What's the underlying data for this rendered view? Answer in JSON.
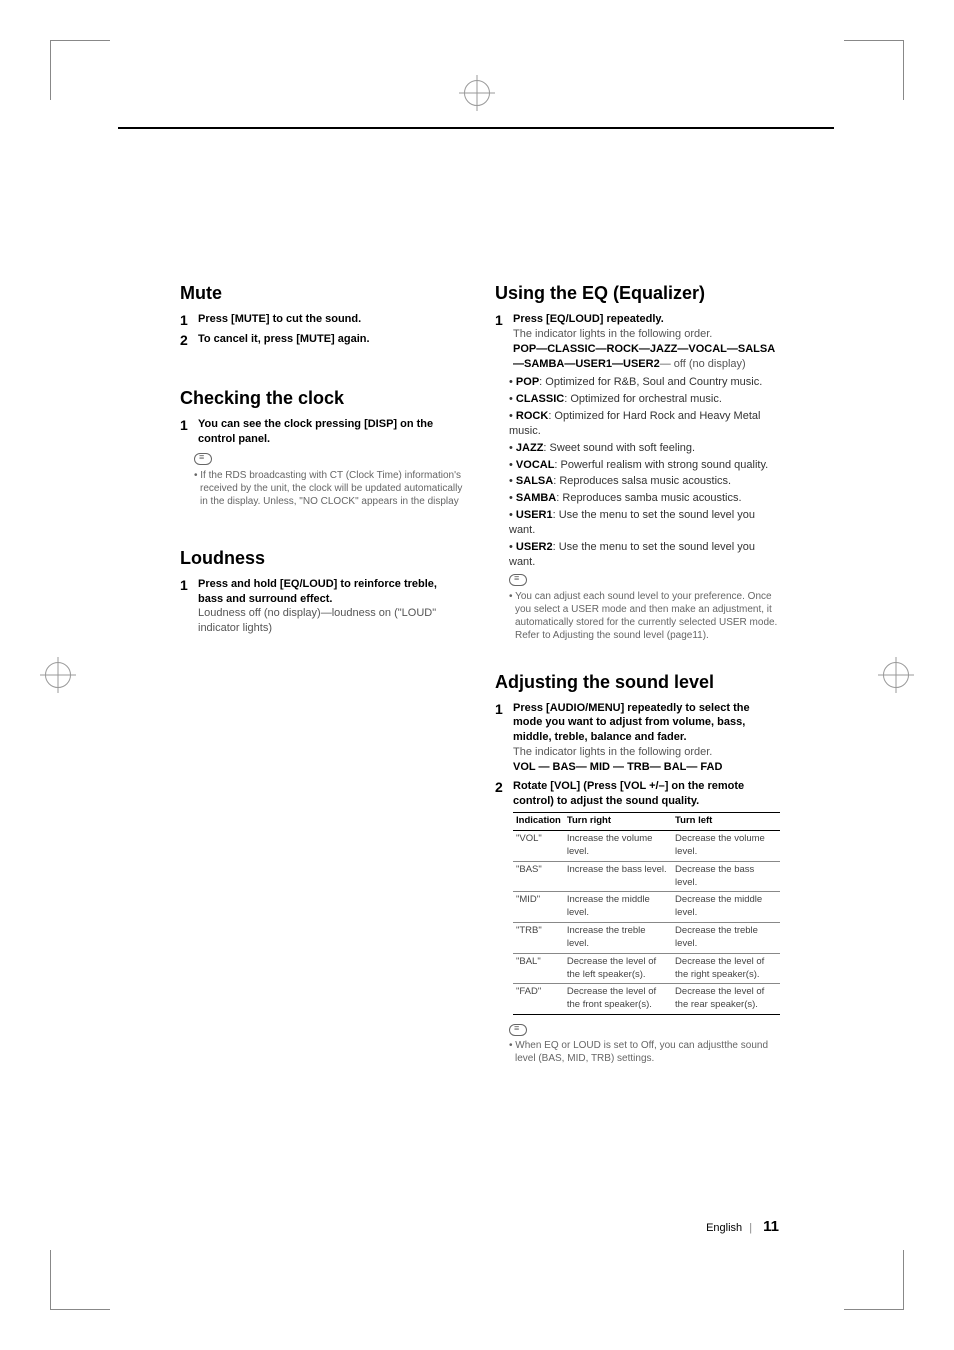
{
  "left": {
    "mute": {
      "heading": "Mute",
      "steps": [
        {
          "num": "1",
          "bold": "Press [MUTE] to cut the sound."
        },
        {
          "num": "2",
          "bold": "To cancel it, press [MUTE] again."
        }
      ]
    },
    "clock": {
      "heading": "Checking the clock",
      "step_num": "1",
      "step_bold": "You can see the clock pressing [DISP] on the control panel.",
      "note": "If the RDS broadcasting with CT (Clock Time) information's received by the unit, the clock will be updated automatically in the display. Unless, \"NO CLOCK\" appears in the display"
    },
    "loudness": {
      "heading": "Loudness",
      "step_num": "1",
      "step_bold": "Press and hold [EQ/LOUD] to reinforce treble, bass and surround effect.",
      "step_light": "Loudness off (no display)—loudness on (\"LOUD\" indicator lights)"
    }
  },
  "right": {
    "eq": {
      "heading": "Using the EQ (Equalizer)",
      "step_num": "1",
      "step_bold": "Press [EQ/LOUD] repeatedly.",
      "step_light1": "The indicator lights in the following order.",
      "seq_bold": "POP—CLASSIC—ROCK—JAZZ—VOCAL—SALSA—SAMBA—USER1—USER2",
      "seq_light_tail": "— off (no display)",
      "modes": [
        {
          "name": "POP",
          "desc": ": Optimized for R&B, Soul and Country music."
        },
        {
          "name": "CLASSIC",
          "desc": ": Optimized for orchestral music."
        },
        {
          "name": "ROCK",
          "desc": ": Optimized for Hard Rock and Heavy Metal music."
        },
        {
          "name": "JAZZ",
          "desc": ": Sweet sound with soft feeling."
        },
        {
          "name": "VOCAL",
          "desc": ": Powerful realism with strong sound quality."
        },
        {
          "name": "SALSA",
          "desc": ": Reproduces salsa music acoustics."
        },
        {
          "name": "SAMBA",
          "desc": ": Reproduces samba music acoustics."
        },
        {
          "name": "USER1",
          "desc": ": Use the menu to set the sound level you want."
        },
        {
          "name": "USER2",
          "desc": ": Use the menu to set the sound level you want."
        }
      ],
      "note": "You can adjust each sound level to your preference. Once you select a USER mode and then make an adjustment, it automatically stored for the currently selected USER mode. Refer to Adjusting the sound level (page11)."
    },
    "adjust": {
      "heading": "Adjusting the sound level",
      "s1_num": "1",
      "s1_bold": "Press [AUDIO/MENU] repeatedly to select the mode you want to adjust from volume, bass, middle, treble, balance and fader.",
      "s1_light": "The indicator lights in the following order.",
      "s1_seq": "VOL — BAS— MID — TRB— BAL— FAD",
      "s2_num": "2",
      "s2_bold": "Rotate [VOL] (Press [VOL +/–] on the remote control) to adjust the sound quality.",
      "table": {
        "head": [
          "Indication",
          "Turn right",
          "Turn left"
        ],
        "rows": [
          [
            "\"VOL\"",
            "Increase the volume level.",
            "Decrease the volume level."
          ],
          [
            "\"BAS\"",
            "Increase the bass level.",
            "Decrease the bass level."
          ],
          [
            "\"MID\"",
            "Increase the middle level.",
            "Decrease the middle level."
          ],
          [
            "\"TRB\"",
            "Increase the treble level.",
            "Decrease the treble level."
          ],
          [
            "\"BAL\"",
            "Decrease the level of the left speaker(s).",
            "Decrease the level of the right speaker(s)."
          ],
          [
            "\"FAD\"",
            "Decrease the level of the front speaker(s).",
            "Decrease the level of the rear speaker(s)."
          ]
        ]
      },
      "note": "When EQ or LOUD is set to Off, you can adjustthe sound level (BAS, MID, TRB) settings."
    }
  },
  "footer": {
    "lang": "English",
    "page": "11"
  }
}
